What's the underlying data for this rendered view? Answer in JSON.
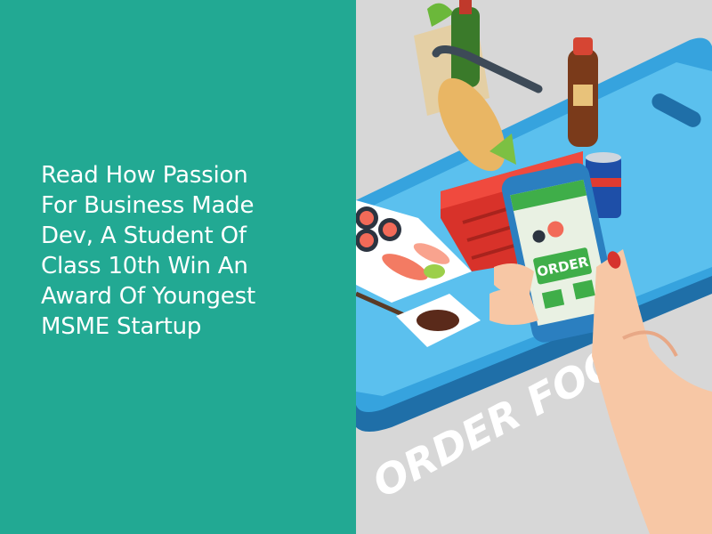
{
  "headline": {
    "lines": [
      "Read How Passion",
      "For Business Made",
      "Dev, A Student Of",
      "Class 10th Win An",
      "Award Of Youngest",
      "MSME Startup"
    ]
  },
  "illustration": {
    "floor_text": "ORDER FOOD",
    "phone_button_text": "ORDER"
  },
  "colors": {
    "panel_teal": "#22a993",
    "background_gray": "#d7d7d7",
    "tablet_blue": "#2e9fd8",
    "basket_red": "#e0382f"
  }
}
